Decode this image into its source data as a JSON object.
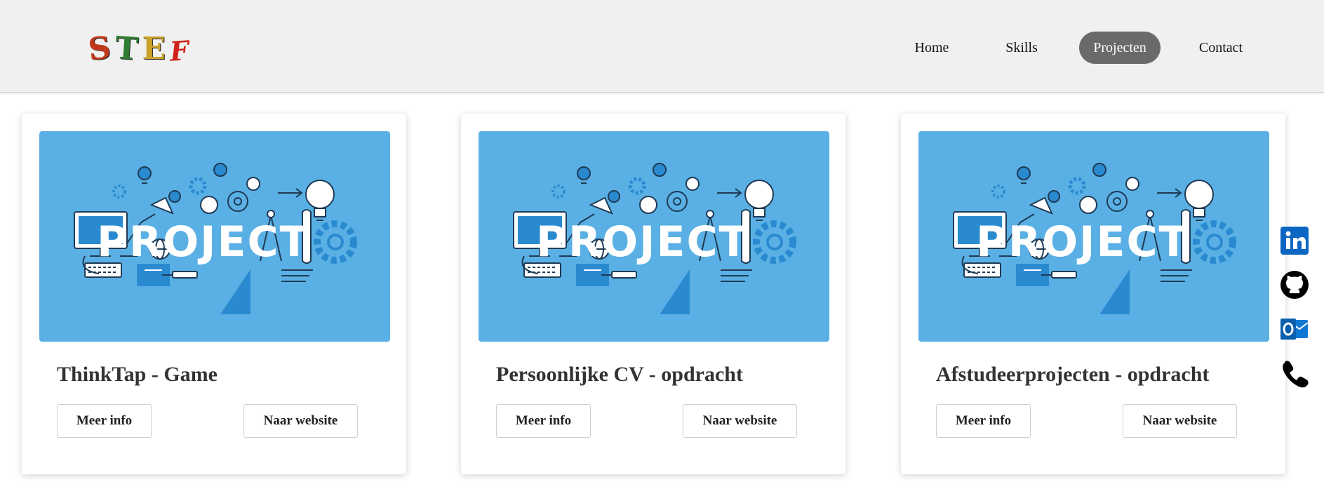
{
  "logo": {
    "letters": [
      "S",
      "T",
      "E",
      "F"
    ]
  },
  "nav": {
    "items": [
      {
        "label": "Home"
      },
      {
        "label": "Skills"
      },
      {
        "label": "Projecten"
      },
      {
        "label": "Contact"
      }
    ],
    "active": "Projecten"
  },
  "thumbnail": {
    "word": "PROJECT"
  },
  "projects": [
    {
      "title": "ThinkTap - Game",
      "info_label": "Meer info",
      "site_label": "Naar website"
    },
    {
      "title": "Persoonlijke CV - opdracht",
      "info_label": "Meer info",
      "site_label": "Naar website"
    },
    {
      "title": "Afstudeerprojecten - opdracht",
      "info_label": "Meer info",
      "site_label": "Naar website"
    }
  ],
  "social": [
    "linkedin-icon",
    "github-icon",
    "outlook-icon",
    "phone-icon"
  ],
  "colors": {
    "header_bg": "#f0f0f0",
    "nav_active_bg": "#6a6a6a",
    "thumb_bg": "#5ab0e4",
    "linkedin": "#0a66c2",
    "outlook": "#0f78d4"
  }
}
